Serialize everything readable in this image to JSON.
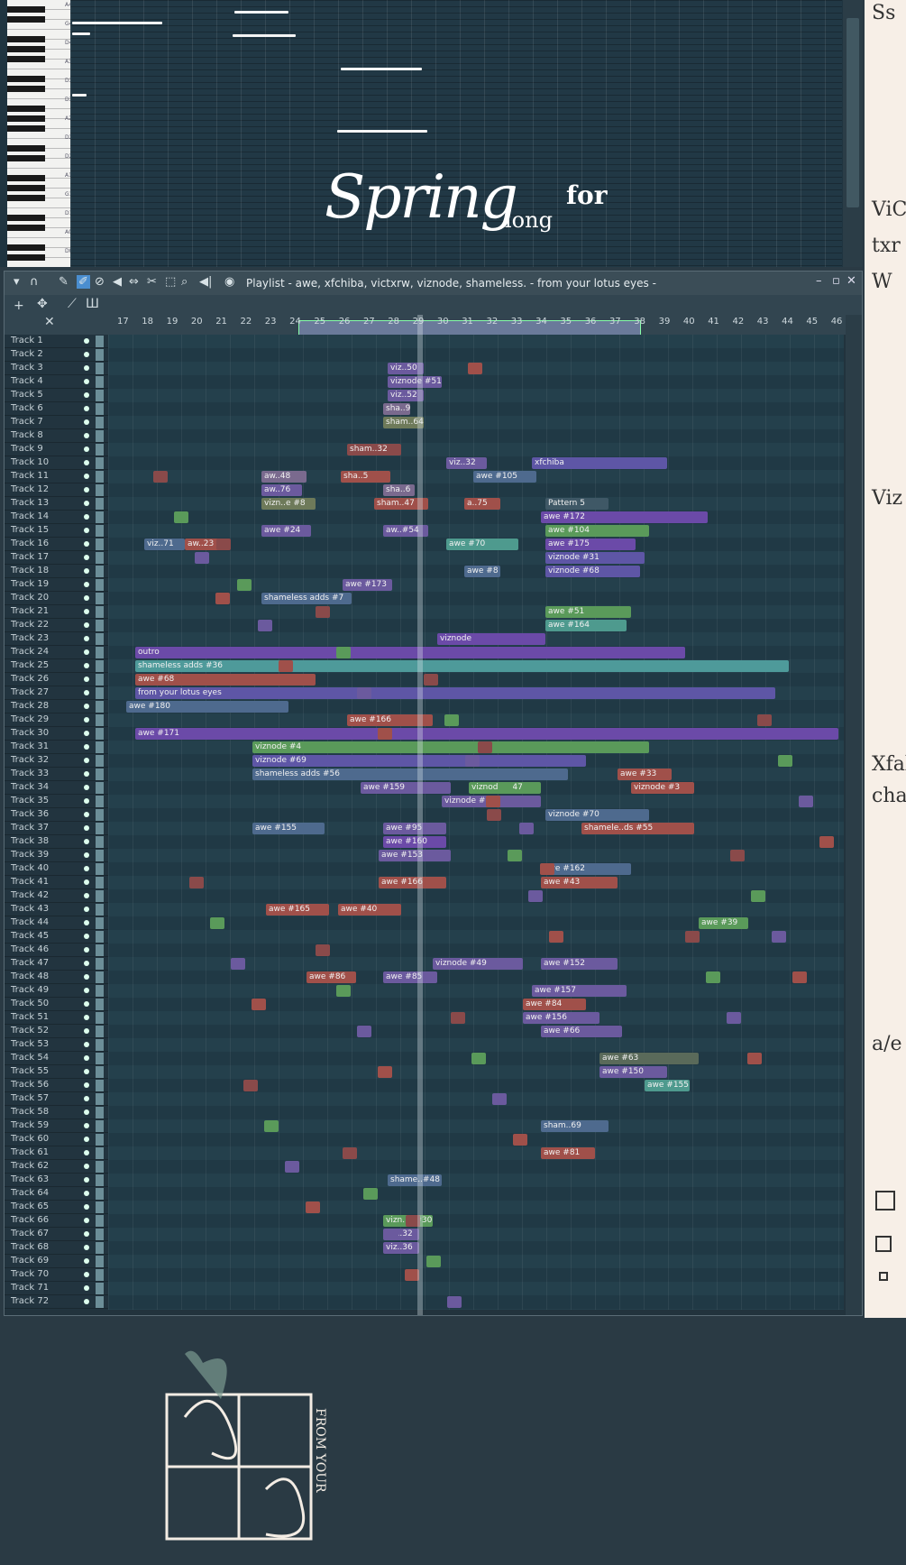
{
  "piano_roll": {
    "key_labels": [
      "A4",
      "G4",
      "D4",
      "A3",
      "D3",
      "D3",
      "A2",
      "D2",
      "D2",
      "A1",
      "G1",
      "D1",
      "A0",
      "D0"
    ],
    "overlay_title": {
      "main": "Spring",
      "small_for": "for",
      "small_long": "long"
    }
  },
  "playlist": {
    "window_title": "Playlist - awe, xfchiba, victxrw, viznode, shameless. - from your lotus eyes -",
    "ruler_ticks": [
      "17",
      "18",
      "19",
      "20",
      "21",
      "22",
      "23",
      "24",
      "25",
      "26",
      "27",
      "28",
      "29",
      "30",
      "31",
      "32",
      "33",
      "34",
      "35",
      "36",
      "37",
      "38",
      "39",
      "40",
      "41",
      "42",
      "43",
      "44",
      "45",
      "46"
    ],
    "tracks": [
      "Track 1",
      "Track 2",
      "Track 3",
      "Track 4",
      "Track 5",
      "Track 6",
      "Track 7",
      "Track 8",
      "Track 9",
      "Track 10",
      "Track 11",
      "Track 12",
      "Track 13",
      "Track 14",
      "Track 15",
      "Track 16",
      "Track 17",
      "Track 18",
      "Track 19",
      "Track 20",
      "Track 21",
      "Track 22",
      "Track 23",
      "Track 24",
      "Track 25",
      "Track 26",
      "Track 27",
      "Track 28",
      "Track 29",
      "Track 30",
      "Track 31",
      "Track 32",
      "Track 33",
      "Track 34",
      "Track 35",
      "Track 36",
      "Track 37",
      "Track 38",
      "Track 39",
      "Track 40",
      "Track 41",
      "Track 42",
      "Track 43",
      "Track 44",
      "Track 45",
      "Track 46",
      "Track 47",
      "Track 48",
      "Track 49",
      "Track 50",
      "Track 51",
      "Track 52",
      "Track 53",
      "Track 54",
      "Track 55",
      "Track 56",
      "Track 57",
      "Track 58",
      "Track 59",
      "Track 60",
      "Track 61",
      "Track 62",
      "Track 63",
      "Track 64",
      "Track 65",
      "Track 66",
      "Track 67",
      "Track 68",
      "Track 69",
      "Track 70",
      "Track 71",
      "Track 72"
    ],
    "clips": [
      {
        "label": "viz..50",
        "color": "#6b5a9e"
      },
      {
        "label": "viznode #51",
        "color": "#6b5a9e"
      },
      {
        "label": "viz..52",
        "color": "#6b5a9e"
      },
      {
        "label": "sha..9",
        "color": "#7a6a8e"
      },
      {
        "label": "sham..64",
        "color": "#6e7a5a"
      },
      {
        "label": "sham..32",
        "color": "#8a4a4a"
      },
      {
        "label": "viz..32",
        "color": "#6b5a9e"
      },
      {
        "label": "xfchiba",
        "color": "#5e56a6"
      },
      {
        "label": "aw..48",
        "color": "#7a6a8e"
      },
      {
        "label": "sha..5",
        "color": "#a0504a"
      },
      {
        "label": "awe #105",
        "color": "#4e6a8e"
      },
      {
        "label": "aw..76",
        "color": "#6b5a9e"
      },
      {
        "label": "sha..6",
        "color": "#7a6a8e"
      },
      {
        "label": "vizn..e #8",
        "color": "#6e7a5a"
      },
      {
        "label": "sham..47",
        "color": "#a0504a"
      },
      {
        "label": "a..75",
        "color": "#a0504a"
      },
      {
        "label": "Pattern 5",
        "color": "#3f5866"
      },
      {
        "label": "awe #172",
        "color": "#6b4aa8"
      },
      {
        "label": "awe #24",
        "color": "#6b5a9e"
      },
      {
        "label": "aw..#54",
        "color": "#6b5a9e"
      },
      {
        "label": "awe #104",
        "color": "#5a9a5a"
      },
      {
        "label": "viz..71",
        "color": "#4e6a8e"
      },
      {
        "label": "aw..23",
        "color": "#a0504a"
      },
      {
        "label": "awe #70",
        "color": "#4e9a8e"
      },
      {
        "label": "awe #175",
        "color": "#6b4aa8"
      },
      {
        "label": "viznode #31",
        "color": "#5e56a6"
      },
      {
        "label": "awe #8",
        "color": "#4e6a8e"
      },
      {
        "label": "viznode #68",
        "color": "#5e56a6"
      },
      {
        "label": "awe #173",
        "color": "#6b5a9e"
      },
      {
        "label": "shameless adds #7",
        "color": "#4e6a8e"
      },
      {
        "label": "awe #51",
        "color": "#5a9a5a"
      },
      {
        "label": "awe #164",
        "color": "#4e9a8e"
      },
      {
        "label": "viznode",
        "color": "#6b4aa8"
      },
      {
        "label": "outro",
        "color": "#6b4aa8"
      },
      {
        "label": "shameless adds #36",
        "color": "#4e9a9a"
      },
      {
        "label": "awe #68",
        "color": "#a0504a"
      },
      {
        "label": "from your lotus eyes",
        "color": "#5e56a6"
      },
      {
        "label": "awe #180",
        "color": "#4e6a8e"
      },
      {
        "label": "awe #166",
        "color": "#a0504a"
      },
      {
        "label": "awe #171",
        "color": "#6b4aa8"
      },
      {
        "label": "viznode #4",
        "color": "#5a9a5a"
      },
      {
        "label": "viznode #69",
        "color": "#5e56a6"
      },
      {
        "label": "shameless adds #56",
        "color": "#4e6a8e"
      },
      {
        "label": "awe #33",
        "color": "#a0504a"
      },
      {
        "label": "awe #159",
        "color": "#6b5a9e"
      },
      {
        "label": "viznode #47",
        "color": "#5a9a5a"
      },
      {
        "label": "viznode #3",
        "color": "#a0504a"
      },
      {
        "label": "viznode #7",
        "color": "#6b5a9e"
      },
      {
        "label": "viznode #70",
        "color": "#4e6a8e"
      },
      {
        "label": "awe #155",
        "color": "#4e6a8e"
      },
      {
        "label": "awe #95",
        "color": "#6b5a9e"
      },
      {
        "label": "shamele..ds #55",
        "color": "#a0504a"
      },
      {
        "label": "awe #160",
        "color": "#6b4aa8"
      },
      {
        "label": "awe #153",
        "color": "#6b5a9e"
      },
      {
        "label": "awe #162",
        "color": "#4e6a8e"
      },
      {
        "label": "awe #166",
        "color": "#a0504a"
      },
      {
        "label": "awe #43",
        "color": "#a0504a"
      },
      {
        "label": "awe #165",
        "color": "#a0504a"
      },
      {
        "label": "awe #40",
        "color": "#a0504a"
      },
      {
        "label": "awe #39",
        "color": "#5a9a5a"
      },
      {
        "label": "viznode #49",
        "color": "#6b5a9e"
      },
      {
        "label": "awe #152",
        "color": "#6b5a9e"
      },
      {
        "label": "awe #86",
        "color": "#a0504a"
      },
      {
        "label": "awe #85",
        "color": "#6b5a9e"
      },
      {
        "label": "awe #157",
        "color": "#6b5a9e"
      },
      {
        "label": "awe #84",
        "color": "#a0504a"
      },
      {
        "label": "awe #156",
        "color": "#6b5a9e"
      },
      {
        "label": "awe #66",
        "color": "#6b5a9e"
      },
      {
        "label": "awe #63",
        "color": "#5a6a5a"
      },
      {
        "label": "awe #150",
        "color": "#6b5a9e"
      },
      {
        "label": "awe #155",
        "color": "#4e9a8e"
      },
      {
        "label": "sham..69",
        "color": "#4e6a8e"
      },
      {
        "label": "awe #81",
        "color": "#a0504a"
      },
      {
        "label": "shame..#48",
        "color": "#4e6a8e"
      },
      {
        "label": "vizn..e #30",
        "color": "#5a9a5a"
      },
      {
        "label": "viz..32",
        "color": "#6b5a9e"
      },
      {
        "label": "viz..36",
        "color": "#6b5a9e"
      }
    ]
  },
  "strip": {
    "glyphs": [
      "Ss",
      "ViC",
      "txr",
      "W",
      "Viz",
      "Xfab",
      "cha",
      "a/e"
    ]
  },
  "cover": {
    "letters": "FROM YOUR"
  }
}
